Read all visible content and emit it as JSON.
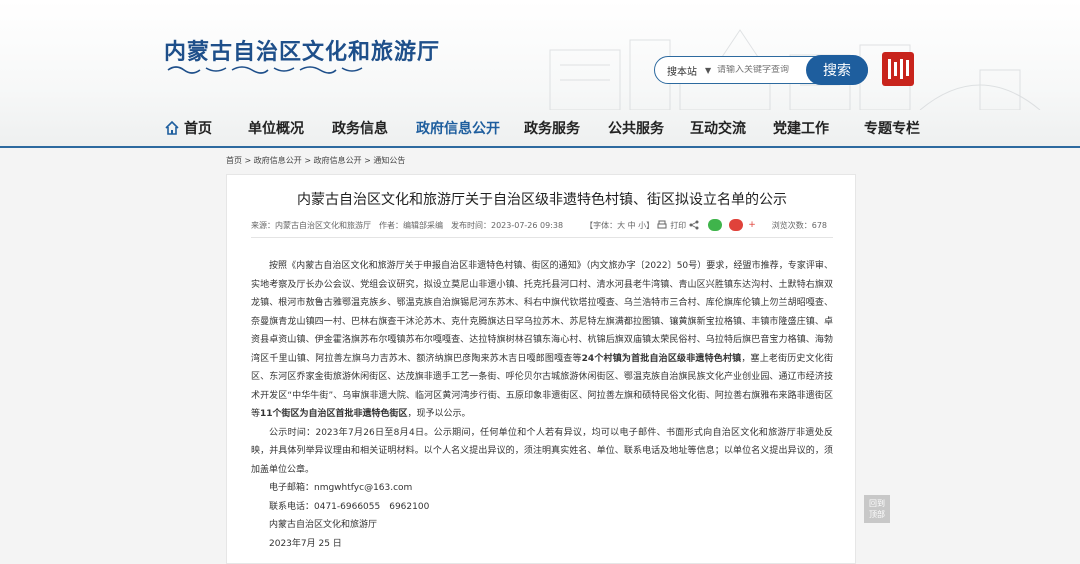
{
  "site": {
    "title": "内蒙古自治区文化和旅游厅",
    "search_scope": "搜本站",
    "search_placeholder": "请输入关键字查询",
    "search_button": "搜索"
  },
  "nav": {
    "items": [
      "首页",
      "单位概况",
      "政务信息",
      "政府信息公开",
      "政务服务",
      "公共服务",
      "互动交流",
      "党建工作",
      "专题专栏"
    ],
    "active": "政府信息公开"
  },
  "breadcrumb": "首页 > 政府信息公开 > 政府信息公开 > 通知公告",
  "article": {
    "title": "内蒙古自治区文化和旅游厅关于自治区级非遗特色村镇、街区拟设立名单的公示",
    "source": "来源：内蒙古自治区文化和旅游厅",
    "author": "作者：编辑部采编",
    "published": "发布时间：2023-07-26 09:38",
    "font_size_label": "【字体：大 中 小】",
    "print_label": "打印",
    "views_label": "浏览次数：678",
    "para1_a": "按照《内蒙古自治区文化和旅游厅关于申报自治区非遗特色村镇、街区的通知》（内文旅办字〔2022〕50号）要求，经盟市推荐，专家评审、实地考察及厅长办公会议、党组会议研究，拟设立莫尼山非遗小镇、托克托县河口村、清水河县老牛湾镇、青山区兴胜镇东达沟村、土默特右旗双龙镇、根河市敖鲁古雅鄂温克族乡、鄂温克族自治旗锡尼河东苏木、科右中旗代钦塔拉嘎查、乌兰浩特市三合村、库伦旗库伦镇上勿兰胡昭嘎查、奈曼旗青龙山镇四一村、巴林右旗查干沐沦苏木、克什克腾旗达日罕乌拉苏木、苏尼特左旗满都拉图镇、镶黄旗新宝拉格镇、丰镇市隆盛庄镇、卓资县卓资山镇、伊金霍洛旗苏布尔嘎镇苏布尔嘎嘎查、达拉特旗树林召镇东海心村、杭锦后旗双庙镇太荣民俗村、乌拉特后旗巴音宝力格镇、海勃湾区千里山镇、阿拉善左旗乌力吉苏木、额济纳旗巴彦陶来苏木吉日嘎郎图嘎查等",
    "para1_bold1": "24个村镇为首批自治区级非遗特色村镇",
    "para1_b": "，塞上老街历史文化街区、东河区乔家金街旅游休闲街区、达茂旗非遗手工艺一条街、呼伦贝尔古城旅游休闲街区、鄂温克族自治旗民族文化产业创业园、通辽市经济技术开发区“中华牛街”、乌审旗非遗大院、临河区黄河湾步行街、五原印象非遗街区、阿拉善左旗和硕特民俗文化街、阿拉善右旗雅布来路非遗街区等",
    "para1_bold2": "11个街区为自治区首批非遗特色街区",
    "para1_c": "，现予以公示。",
    "para2": "公示时间：2023年7月26日至8月4日。公示期间，任何单位和个人若有异议，均可以电子邮件、书面形式向自治区文化和旅游厅非遗处反映，并具体列举异议理由和相关证明材料。以个人名义提出异议的，须注明真实姓名、单位、联系电话及地址等信息；以单位名义提出异议的，须加盖单位公章。",
    "email": "电子邮箱：nmgwhtfyc@163.com",
    "phone": "联系电话：0471-6966055　6962100",
    "signature": "内蒙古自治区文化和旅游厅",
    "date": "2023年7月 25 日"
  },
  "gotop": "回到\n顶部"
}
